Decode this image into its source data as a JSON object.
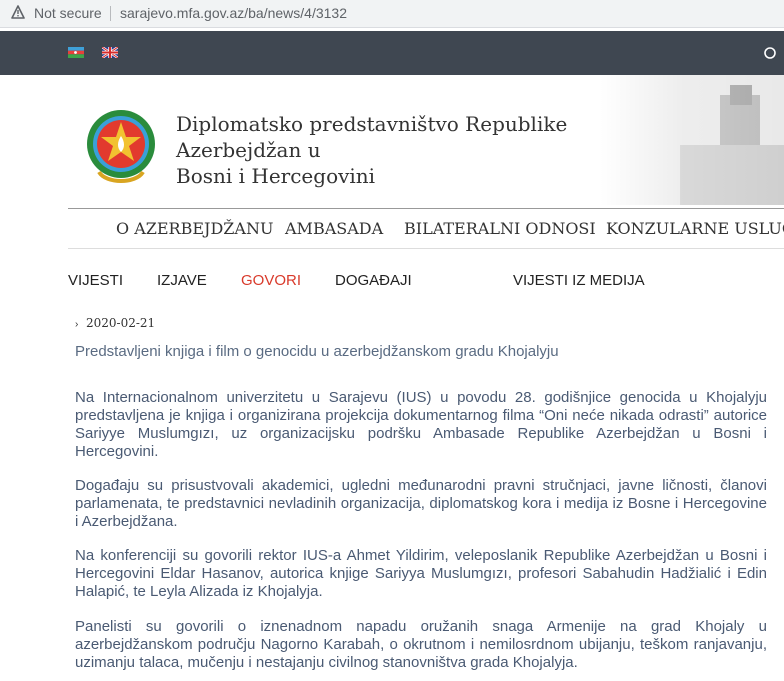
{
  "browser": {
    "security_label": "Not secure",
    "url": "sarajevo.mfa.gov.az/ba/news/4/3132"
  },
  "site": {
    "title_line1": "Diplomatsko predstavništvo Republike Azerbejdžan u",
    "title_line2": "Bosni i Hercegovini"
  },
  "main_nav": [
    {
      "label": "O AZERBEJDŽANU"
    },
    {
      "label": "AMBASADA"
    },
    {
      "label": "BILATERALNI ODNOSI"
    },
    {
      "label": "KONZULARNE USLUGE"
    }
  ],
  "sub_nav": [
    {
      "label": "VIJESTI",
      "active": false
    },
    {
      "label": "IZJAVE",
      "active": false
    },
    {
      "label": "GOVORI",
      "active": true
    },
    {
      "label": "DOGAĐAJI",
      "active": false
    },
    {
      "label": "VIJESTI IZ MEDIJA",
      "active": false
    }
  ],
  "article": {
    "date": "2020-02-21",
    "title": "Predstavljeni knjiga i film o genocidu u azerbejdžanskom gradu Khojalyju",
    "paragraphs": [
      "Na Internacionalnom univerzitetu u Sarajevu (IUS) u povodu 28. godišnjice genocida u Khojalyju predstavljena je knjiga i organizirana projekcija dokumentarnog filma “Oni neće nikada odrasti” autorice Sariyye Muslumgızı, uz organizacijsku podršku Ambasade Republike Azerbejdžan u Bosni i Hercegovini.",
      "Događaju su prisustvovali akademici, ugledni međunarodni pravni stručnjaci, javne ličnosti, članovi parlamenata, te predstavnici nevladinih organizacija, diplomatskog kora i medija iz Bosne i Hercegovine i Azerbejdžana.",
      "Na konferenciji su govorili rektor IUS-a Ahmet Yildirim, veleposlanik Republike Azerbejdžan u Bosni i Hercegovini Eldar Hasanov, autorica knjige Sariyya Muslumgızı, profesori Sabahudin Hadžialić i Edin Halapić, te Leyla Alizada iz Khojalyja.",
      "Panelisti su govorili o iznenadnom napadu oružanih snaga Armenije na grad Khojaly u azerbejdžanskom području Nagorno Karabah, o okrutnom i nemilosrdnom ubijanju, teškom ranjavanju, uzimanju talaca, mučenju i nestajanju civilnog stanovništva grada Khojalyja."
    ]
  },
  "colors": {
    "topbar": "#3f4751",
    "active_nav": "#d93a2b",
    "body_text": "#4a5a73"
  },
  "icons": [
    "warning-icon",
    "flag-az-icon",
    "flag-uk-icon",
    "search-icon",
    "emblem-logo",
    "chevron-right-icon"
  ]
}
